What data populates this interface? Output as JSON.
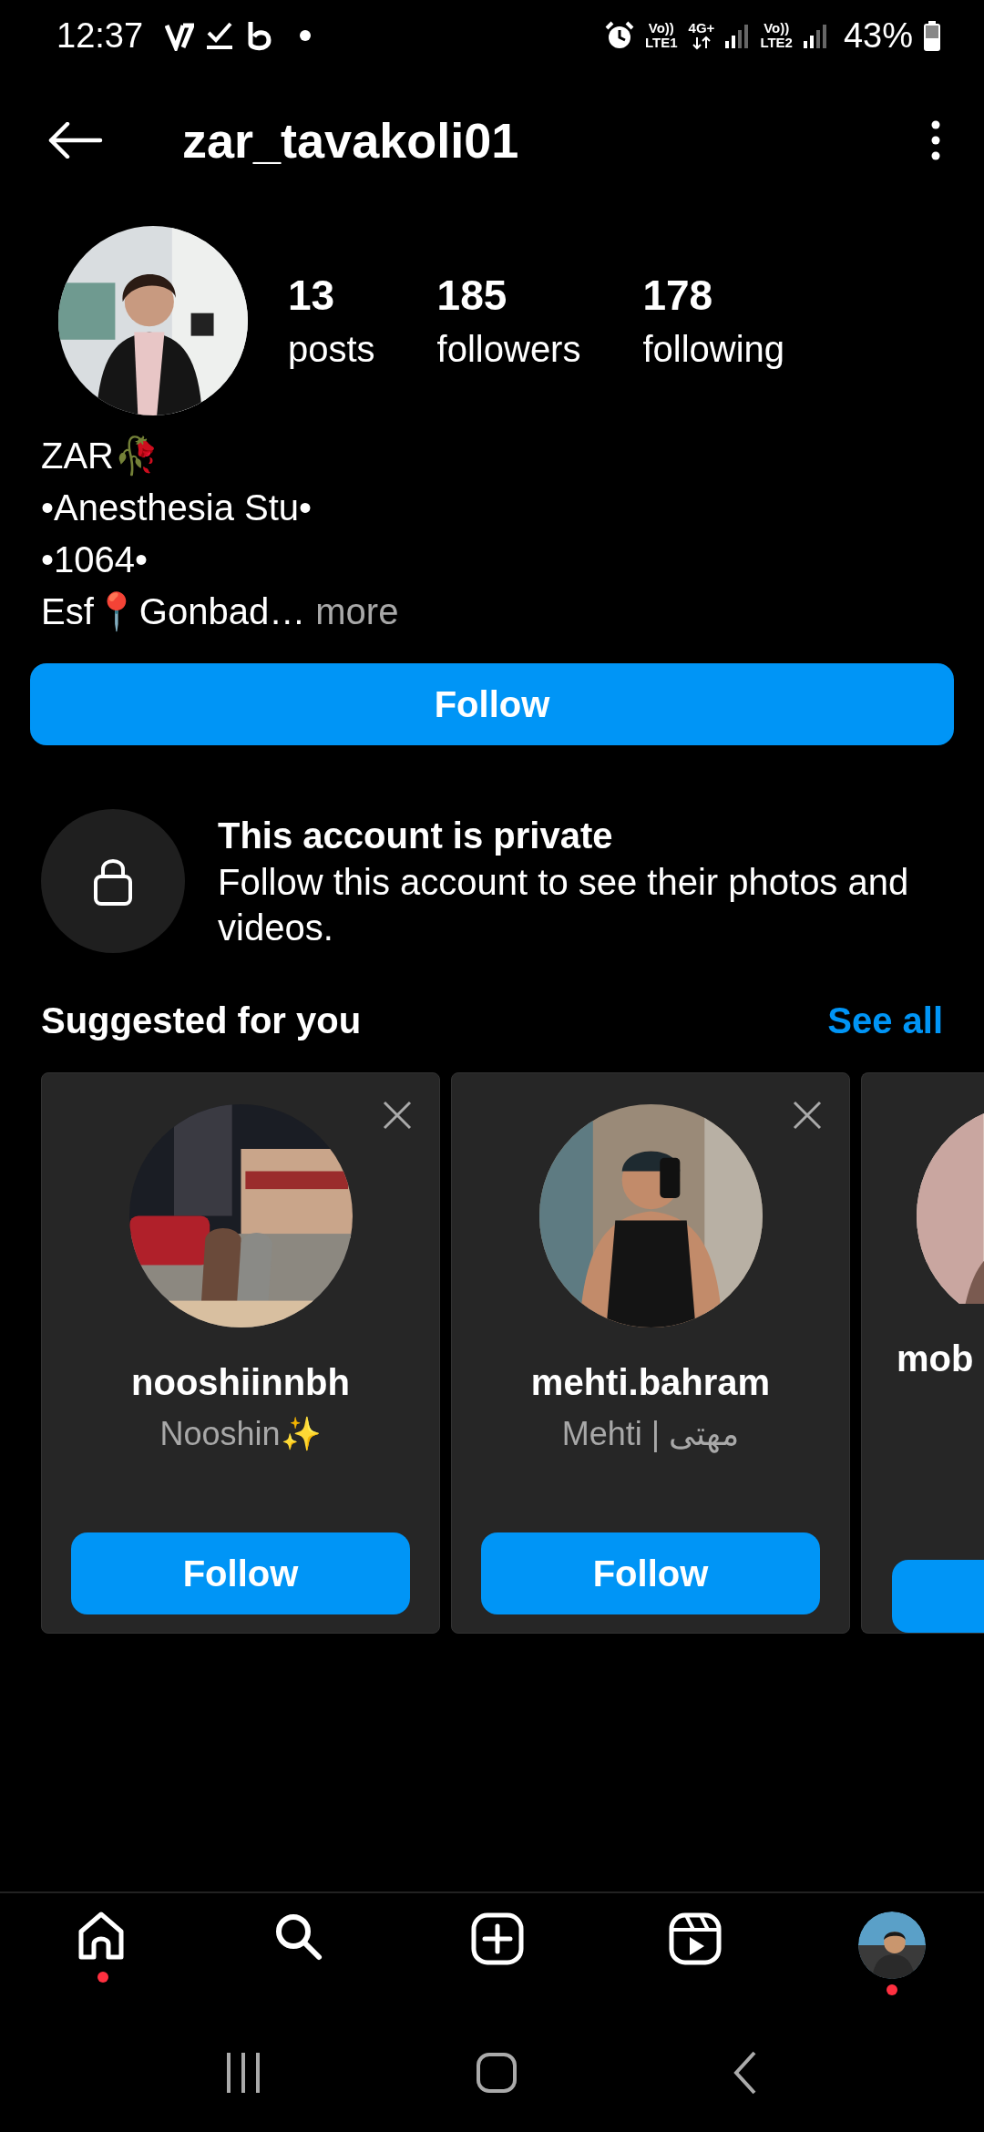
{
  "status_bar": {
    "time": "12:37",
    "sim1_top": "Vo))",
    "sim1_bottom": "LTE1",
    "data_top": "4G+",
    "sim2_top": "Vo))",
    "sim2_bottom": "LTE2",
    "battery": "43%"
  },
  "header": {
    "username": "zar_tavakoli01"
  },
  "stats": [
    {
      "count": "13",
      "label": "posts"
    },
    {
      "count": "185",
      "label": "followers"
    },
    {
      "count": "178",
      "label": "following"
    }
  ],
  "bio": [
    {
      "parts": [
        {
          "text": "ZAR🥀"
        }
      ]
    },
    {
      "parts": [
        {
          "text": "•Anesthesia Stu•"
        }
      ]
    },
    {
      "parts": [
        {
          "text": "•1064•"
        }
      ]
    },
    {
      "parts": [
        {
          "text": "Esf📍Gonbad…"
        }
      ],
      "more": "more"
    }
  ],
  "follow_button": "Follow",
  "private_notice": {
    "title": "This account is private",
    "body": "Follow this account to see their photos and videos."
  },
  "suggested": {
    "title": "Suggested for you",
    "see_all": "See all",
    "cards": [
      {
        "kind": "full",
        "username": "nooshiinnbh",
        "subtitle": [
          {
            "text": "Nooshin✨"
          }
        ],
        "button": "Follow"
      },
      {
        "kind": "full",
        "username": "mehti.bahram",
        "subtitle": [
          {
            "text": "Mehti | مهتی"
          }
        ],
        "button": "Follow"
      },
      {
        "kind": "partial",
        "username": "mob"
      }
    ]
  },
  "bottom_nav": [
    {
      "kind": "home",
      "dot": true
    },
    {
      "kind": "search",
      "dot": false
    },
    {
      "kind": "create",
      "dot": false
    },
    {
      "kind": "reels",
      "dot": false
    },
    {
      "kind": "profile",
      "dot": true
    }
  ]
}
